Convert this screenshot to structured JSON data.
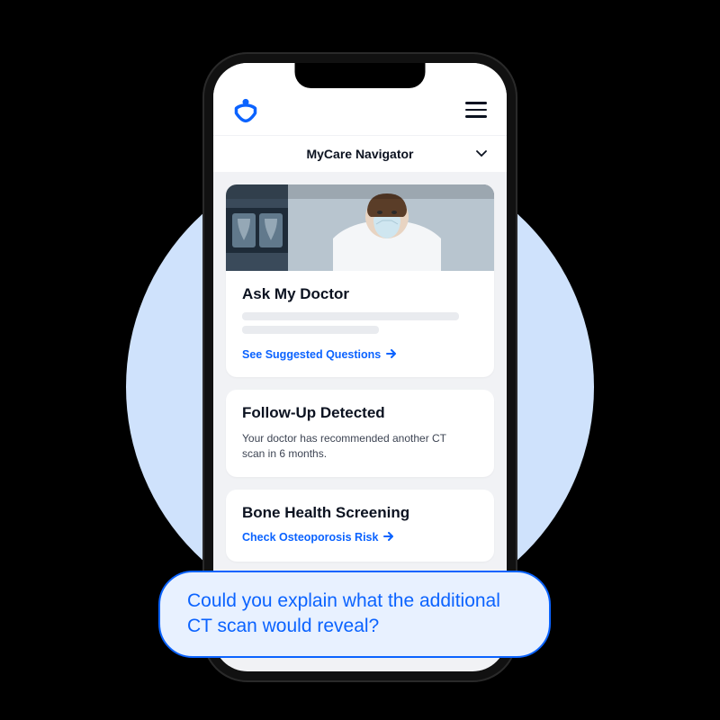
{
  "colors": {
    "primary": "#0b63ff",
    "bg_circle": "#cfe2fc",
    "screen": "#f1f2f5"
  },
  "header": {
    "logo_name": "app-logo"
  },
  "nav": {
    "title": "MyCare Navigator"
  },
  "cards": {
    "ask": {
      "title": "Ask My Doctor",
      "link": "See Suggested Questions"
    },
    "followup": {
      "title": "Follow-Up Detected",
      "body": "Your doctor has recommended another CT scan in 6 months."
    },
    "bone": {
      "title": "Bone Health Screening",
      "link": "Check Osteoporosis Risk"
    }
  },
  "bubble": {
    "text": "Could you explain what the additional CT scan would reveal?"
  }
}
